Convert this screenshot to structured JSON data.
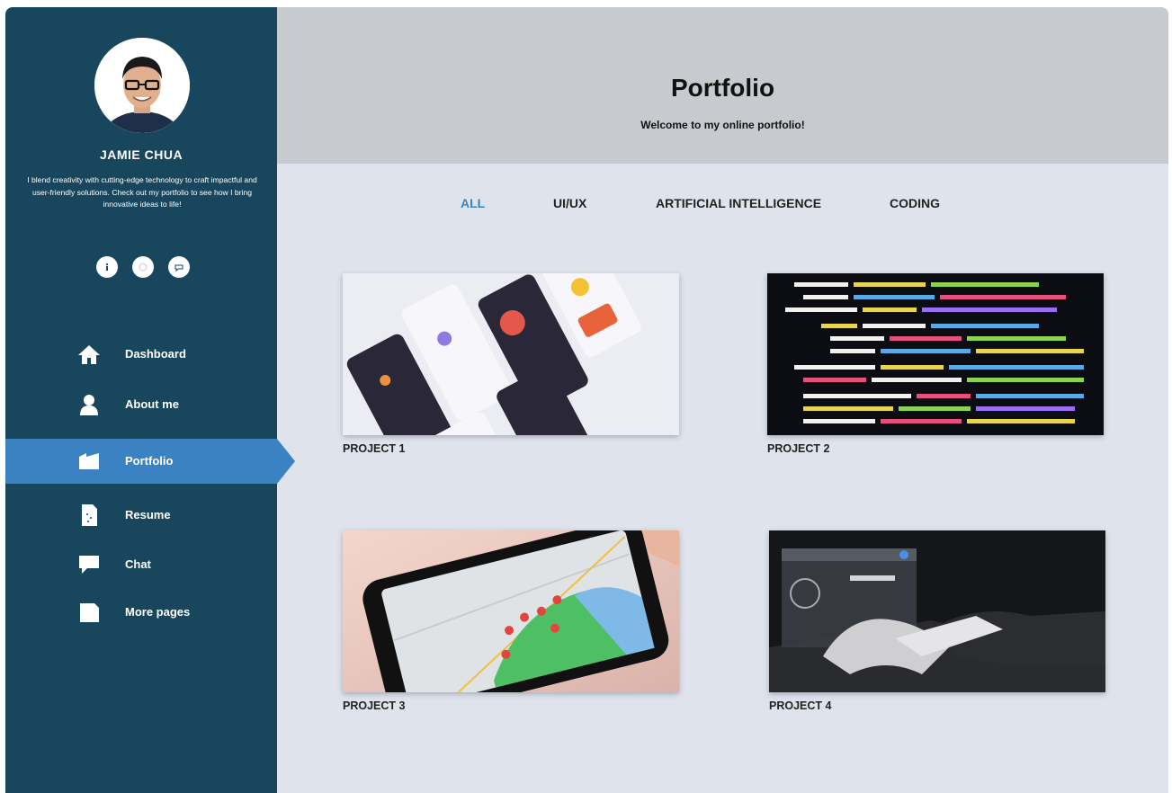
{
  "profile": {
    "name": "JAMIE CHUA",
    "bio": "I blend creativity with cutting-edge technology to craft impactful and user-friendly solutions. Check out my portfolio to see how I bring innovative ideas to life!"
  },
  "socials": [
    {
      "icon": "info-icon"
    },
    {
      "icon": "globe-icon"
    },
    {
      "icon": "message-icon"
    }
  ],
  "nav": {
    "items": [
      {
        "label": "Dashboard",
        "icon": "home-icon"
      },
      {
        "label": "About me",
        "icon": "user-icon"
      },
      {
        "label": "Portfolio",
        "icon": "folder-icon",
        "active": true
      },
      {
        "label": "Resume",
        "icon": "document-icon"
      },
      {
        "label": "Chat",
        "icon": "chat-icon"
      },
      {
        "label": "More pages",
        "icon": "page-icon"
      }
    ]
  },
  "header": {
    "title": "Portfolio",
    "subtitle": "Welcome to my online portfolio!"
  },
  "filters": {
    "items": [
      {
        "label": "ALL",
        "active": true
      },
      {
        "label": "UI/UX"
      },
      {
        "label": "ARTIFICIAL INTELLIGENCE"
      },
      {
        "label": "CODING"
      }
    ]
  },
  "projects": {
    "items": [
      {
        "label": "PROJECT 1"
      },
      {
        "label": "PROJECT 2"
      },
      {
        "label": "PROJECT 3"
      },
      {
        "label": "PROJECT 4"
      }
    ]
  },
  "colors": {
    "sidebar": "#17465d",
    "accent": "#3b82c3",
    "header": "#c7cacf",
    "content": "#dfe3ec"
  }
}
